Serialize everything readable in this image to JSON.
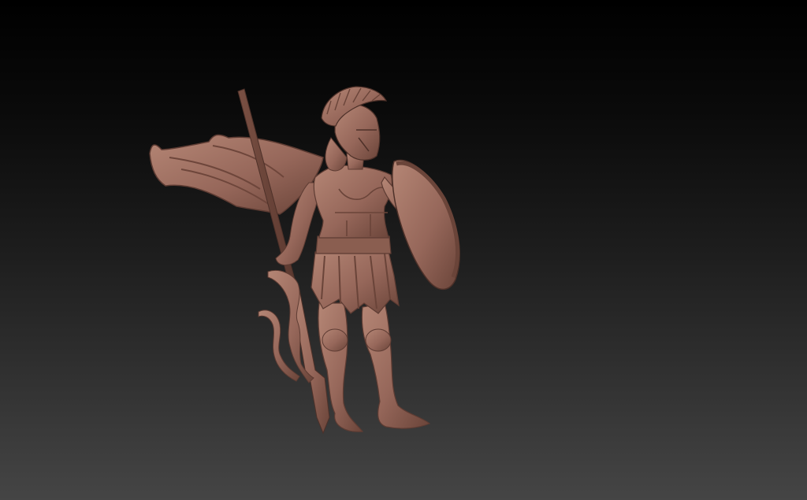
{
  "viewport": {
    "background_top": "#000000",
    "background_bottom": "#454545"
  },
  "model": {
    "subject": "spartan-warrior-sculpt",
    "material_color": "#9a6a5a",
    "material_shadow": "#6e463b",
    "material_highlight": "#b98a78"
  }
}
